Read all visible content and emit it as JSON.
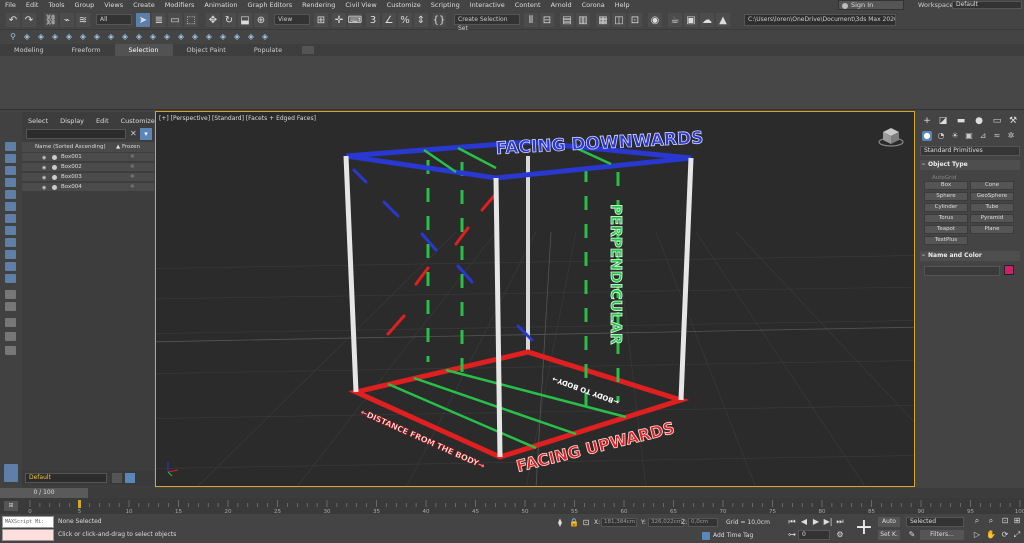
{
  "menu": [
    "File",
    "Edit",
    "Tools",
    "Group",
    "Views",
    "Create",
    "Modifiers",
    "Animation",
    "Graph Editors",
    "Rendering",
    "Civil View",
    "Customize",
    "Scripting",
    "Interactive",
    "Content",
    "Arnold",
    "Corona",
    "Help"
  ],
  "signin": "Sign In",
  "workspaces_label": "Workspaces:",
  "workspace": "Default",
  "toolbar": {
    "filter": "All",
    "refcoord": "View",
    "selection_set": "Create Selection Set",
    "path": "C:\\Users\\loren\\OneDrive\\Document\\3ds Max 2020"
  },
  "ribbon_tabs": [
    "Modeling",
    "Freeform",
    "Selection",
    "Object Paint",
    "Populate"
  ],
  "ribbon_active": 2,
  "explorer": {
    "menu": [
      "Select",
      "Display",
      "Edit",
      "Customize"
    ],
    "col_name": "Name (Sorted Ascending)",
    "col_frozen": "▲ Frozen",
    "rows": [
      "Box001",
      "Box002",
      "Box003",
      "Box004"
    ],
    "layer": "Default"
  },
  "viewport": {
    "label": "[+] [Perspective] [Standard] [Facets + Edged Faces]",
    "text_top": "FACING DOWNWARDS",
    "text_bottom": "FACING UPWARDS",
    "text_side": "PERPENDICULAR",
    "text_left": "←DISTANCE FROM THE BODY→",
    "text_back": "←BODY TO BODY→"
  },
  "cmdpanel": {
    "dropdown": "Standard Primitives",
    "object_type": "Object Type",
    "autogrid": "AutoGrid",
    "buttons": [
      "Box",
      "Cone",
      "Sphere",
      "GeoSphere",
      "Cylinder",
      "Tube",
      "Torus",
      "Pyramid",
      "Teapot",
      "Plane",
      "TextPlus"
    ],
    "name_color": "Name and Color"
  },
  "timeslider": "0 / 100",
  "status": {
    "maxscript": "MAXScript Mi:",
    "selection": "None Selected",
    "prompt": "Click or click-and-drag to select objects",
    "x_label": "X:",
    "x": "181,384cm",
    "y_label": "Y:",
    "y": "326,022cm",
    "z_label": "Z:",
    "z": "0,0cm",
    "grid": "Grid = 10,0cm",
    "add_time_tag": "Add Time Tag",
    "frame": "0",
    "auto": "Auto",
    "setk": "Set K.",
    "selected": "Selected",
    "filters": "Filters..."
  },
  "ticks": [
    "0",
    "5",
    "10",
    "15",
    "20",
    "25",
    "30",
    "35",
    "40",
    "45",
    "50",
    "55",
    "60",
    "65",
    "70",
    "75",
    "80",
    "85",
    "90",
    "95",
    "100"
  ],
  "colors": {
    "accent": "#d4a827",
    "blue": "#5a86b8",
    "red": "#e02020",
    "green": "#28c048",
    "navy": "#2838d0"
  }
}
